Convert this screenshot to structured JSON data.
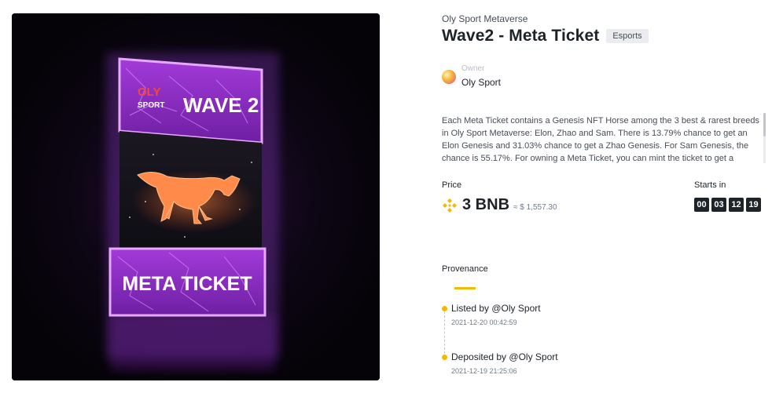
{
  "artwork": {
    "top_brand": "OLY SPORT",
    "top_text": "WAVE 2",
    "bottom_text": "META TICKET",
    "accent_color": "#c94fff"
  },
  "collection": "Oly Sport Metaverse",
  "title": "Wave2 - Meta Ticket",
  "category_badge": "Esports",
  "owner": {
    "label": "Owner",
    "name": "Oly Sport"
  },
  "description": "Each Meta Ticket contains a Genesis NFT Horse among the 3 best & rarest breeds in Oly Sport Metaverse: Elon, Zhao and Sam. There is 13.79% chance to get an Elon Genesis and 31.03% chance to get a Zhao Genesis. For Sam Genesis, the chance is 55.17%. For owning a Meta Ticket, you can mint the ticket to get a",
  "price": {
    "label": "Price",
    "value": "3 BNB",
    "usd": "≈ $ 1,557.30",
    "currency_icon": "bnb-icon",
    "currency_color": "#f0b90b"
  },
  "starts": {
    "label": "Starts in",
    "days": "00",
    "hours": "03",
    "minutes": "12",
    "seconds": "19"
  },
  "provenance": {
    "label": "Provenance",
    "events": [
      {
        "action": "Listed by",
        "user": "@Oly Sport",
        "date": "2021-12-20 00:42:59"
      },
      {
        "action": "Deposited by",
        "user": "@Oly Sport",
        "date": "2021-12-19 21:25:06"
      }
    ]
  }
}
